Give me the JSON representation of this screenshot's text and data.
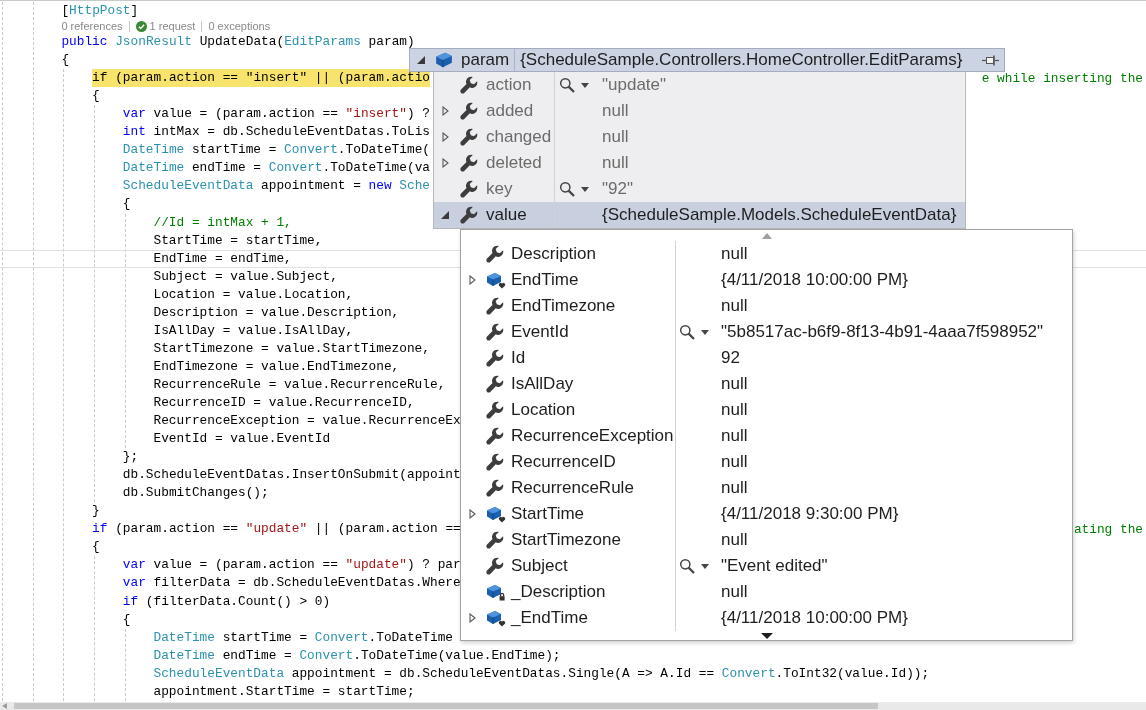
{
  "editor": {
    "lines": [
      {
        "kind": "code",
        "current": false,
        "caret": false,
        "tokens": [
          {
            "text": "[",
            "kind": "plain"
          },
          {
            "text": "HttpPost",
            "kind": "type"
          },
          {
            "text": "]",
            "kind": "plain"
          }
        ]
      },
      {
        "kind": "codelens",
        "items": [
          {
            "text": "0 references",
            "passed": false
          },
          {
            "text": "1 request",
            "passed": true
          },
          {
            "text": "0 exceptions",
            "passed": false
          }
        ]
      },
      {
        "kind": "code",
        "current": false,
        "caret": false,
        "tokens": [
          {
            "text": "public ",
            "kind": "keyword"
          },
          {
            "text": "JsonResult",
            "kind": "type"
          },
          {
            "text": " UpdateData(",
            "kind": "plain"
          },
          {
            "text": "EditParams",
            "kind": "type"
          },
          {
            "text": " param)",
            "kind": "plain"
          }
        ]
      },
      {
        "kind": "code",
        "current": false,
        "caret": false,
        "tokens": [
          {
            "text": "{",
            "kind": "plain"
          }
        ],
        "children": [
          {
            "kind": "code",
            "current": true,
            "caret": false,
            "tokens": [
              {
                "text": "if (param.action == \"insert\" || (param.actio",
                "kind": "plain"
              }
            ],
            "tail": {
              "text": "e while inserting the",
              "kind": "comment"
            }
          },
          {
            "kind": "code",
            "current": false,
            "caret": false,
            "tokens": [
              {
                "text": "{",
                "kind": "plain"
              }
            ],
            "children": [
              {
                "kind": "code",
                "current": false,
                "caret": false,
                "tokens": [
                  {
                    "text": "var ",
                    "kind": "keyword"
                  },
                  {
                    "text": "value = (param.action == ",
                    "kind": "plain"
                  },
                  {
                    "text": "\"insert\"",
                    "kind": "string"
                  },
                  {
                    "text": ") ?",
                    "kind": "plain"
                  }
                ]
              },
              {
                "kind": "code",
                "current": false,
                "caret": false,
                "tokens": [
                  {
                    "text": "int ",
                    "kind": "keyword"
                  },
                  {
                    "text": "intMax = db.ScheduleEventDatas.ToLis",
                    "kind": "plain"
                  }
                ]
              },
              {
                "kind": "code",
                "current": false,
                "caret": false,
                "tokens": [
                  {
                    "text": "DateTime",
                    "kind": "type"
                  },
                  {
                    "text": " startTime = ",
                    "kind": "plain"
                  },
                  {
                    "text": "Convert",
                    "kind": "type"
                  },
                  {
                    "text": ".ToDateTime(",
                    "kind": "plain"
                  }
                ]
              },
              {
                "kind": "code",
                "current": false,
                "caret": false,
                "tokens": [
                  {
                    "text": "DateTime",
                    "kind": "type"
                  },
                  {
                    "text": " endTime = ",
                    "kind": "plain"
                  },
                  {
                    "text": "Convert",
                    "kind": "type"
                  },
                  {
                    "text": ".ToDateTime(va",
                    "kind": "plain"
                  }
                ]
              },
              {
                "kind": "code",
                "current": false,
                "caret": false,
                "tokens": [
                  {
                    "text": "ScheduleEventData",
                    "kind": "type"
                  },
                  {
                    "text": " appointment = ",
                    "kind": "plain"
                  },
                  {
                    "text": "new ",
                    "kind": "keyword"
                  },
                  {
                    "text": "Sche",
                    "kind": "type"
                  }
                ]
              },
              {
                "kind": "code",
                "current": false,
                "caret": false,
                "tokens": [
                  {
                    "text": "{",
                    "kind": "plain"
                  }
                ],
                "children": [
                  {
                    "kind": "code",
                    "current": false,
                    "caret": false,
                    "tokens": [
                      {
                        "text": "//Id = intMax + 1,",
                        "kind": "comment"
                      }
                    ]
                  },
                  {
                    "kind": "code",
                    "current": false,
                    "caret": false,
                    "tokens": [
                      {
                        "text": "StartTime = startTime,",
                        "kind": "plain"
                      }
                    ]
                  },
                  {
                    "kind": "code",
                    "current": false,
                    "caret": true,
                    "tokens": [
                      {
                        "text": "EndTime = endTime,",
                        "kind": "plain"
                      }
                    ]
                  },
                  {
                    "kind": "code",
                    "current": false,
                    "caret": false,
                    "tokens": [
                      {
                        "text": "Subject = value.Subject,",
                        "kind": "plain"
                      }
                    ]
                  },
                  {
                    "kind": "code",
                    "current": false,
                    "caret": false,
                    "tokens": [
                      {
                        "text": "Location = value.Location,",
                        "kind": "plain"
                      }
                    ]
                  },
                  {
                    "kind": "code",
                    "current": false,
                    "caret": false,
                    "tokens": [
                      {
                        "text": "Description = value.Description,",
                        "kind": "plain"
                      }
                    ]
                  },
                  {
                    "kind": "code",
                    "current": false,
                    "caret": false,
                    "tokens": [
                      {
                        "text": "IsAllDay = value.IsAllDay,",
                        "kind": "plain"
                      }
                    ]
                  },
                  {
                    "kind": "code",
                    "current": false,
                    "caret": false,
                    "tokens": [
                      {
                        "text": "StartTimezone = value.StartTimezone,",
                        "kind": "plain"
                      }
                    ]
                  },
                  {
                    "kind": "code",
                    "current": false,
                    "caret": false,
                    "tokens": [
                      {
                        "text": "EndTimezone = value.EndTimezone,",
                        "kind": "plain"
                      }
                    ]
                  },
                  {
                    "kind": "code",
                    "current": false,
                    "caret": false,
                    "tokens": [
                      {
                        "text": "RecurrenceRule = value.RecurrenceRule,",
                        "kind": "plain"
                      }
                    ]
                  },
                  {
                    "kind": "code",
                    "current": false,
                    "caret": false,
                    "tokens": [
                      {
                        "text": "RecurrenceID = value.RecurrenceID,",
                        "kind": "plain"
                      }
                    ]
                  },
                  {
                    "kind": "code",
                    "current": false,
                    "caret": false,
                    "tokens": [
                      {
                        "text": "RecurrenceException = value.RecurrenceEx",
                        "kind": "plain"
                      }
                    ]
                  },
                  {
                    "kind": "code",
                    "current": false,
                    "caret": false,
                    "tokens": [
                      {
                        "text": "EventId = value.EventId",
                        "kind": "plain"
                      }
                    ]
                  }
                ]
              },
              {
                "kind": "code",
                "current": false,
                "caret": false,
                "tokens": [
                  {
                    "text": "};",
                    "kind": "plain"
                  }
                ]
              },
              {
                "kind": "code",
                "current": false,
                "caret": false,
                "tokens": [
                  {
                    "text": "db.ScheduleEventDatas.InsertOnSubmit(appoint",
                    "kind": "plain"
                  }
                ]
              },
              {
                "kind": "code",
                "current": false,
                "caret": false,
                "tokens": [
                  {
                    "text": "db.SubmitChanges();",
                    "kind": "plain"
                  }
                ]
              }
            ]
          },
          {
            "kind": "code",
            "current": false,
            "caret": false,
            "tokens": [
              {
                "text": "}",
                "kind": "plain"
              }
            ]
          },
          {
            "kind": "code",
            "current": false,
            "caret": false,
            "tokens": [
              {
                "text": "if ",
                "kind": "keyword"
              },
              {
                "text": "(param.action == ",
                "kind": "plain"
              },
              {
                "text": "\"update\"",
                "kind": "string"
              },
              {
                "text": " || (param.action ==",
                "kind": "plain"
              }
            ],
            "tail": {
              "text": "ating the",
              "kind": "comment"
            }
          },
          {
            "kind": "code",
            "current": false,
            "caret": false,
            "tokens": [
              {
                "text": "{",
                "kind": "plain"
              }
            ],
            "children": [
              {
                "kind": "code",
                "current": false,
                "caret": false,
                "tokens": [
                  {
                    "text": "var ",
                    "kind": "keyword"
                  },
                  {
                    "text": "value = (param.action == ",
                    "kind": "plain"
                  },
                  {
                    "text": "\"update\"",
                    "kind": "string"
                  },
                  {
                    "text": ") ? par",
                    "kind": "plain"
                  }
                ]
              },
              {
                "kind": "code",
                "current": false,
                "caret": false,
                "tokens": [
                  {
                    "text": "var ",
                    "kind": "keyword"
                  },
                  {
                    "text": "filterData = db.ScheduleEventDatas.Where",
                    "kind": "plain"
                  }
                ]
              },
              {
                "kind": "code",
                "current": false,
                "caret": false,
                "tokens": [
                  {
                    "text": "if ",
                    "kind": "keyword"
                  },
                  {
                    "text": "(filterData.Count() > 0)",
                    "kind": "plain"
                  }
                ]
              },
              {
                "kind": "code",
                "current": false,
                "caret": false,
                "tokens": [
                  {
                    "text": "{",
                    "kind": "plain"
                  }
                ],
                "children": [
                  {
                    "kind": "code",
                    "current": false,
                    "caret": false,
                    "tokens": [
                      {
                        "text": "DateTime",
                        "kind": "type"
                      },
                      {
                        "text": " startTime = ",
                        "kind": "plain"
                      },
                      {
                        "text": "Convert",
                        "kind": "type"
                      },
                      {
                        "text": ".ToDateTime",
                        "kind": "plain"
                      }
                    ]
                  },
                  {
                    "kind": "code",
                    "current": false,
                    "caret": false,
                    "tokens": [
                      {
                        "text": "DateTime",
                        "kind": "type"
                      },
                      {
                        "text": " endTime = ",
                        "kind": "plain"
                      },
                      {
                        "text": "Convert",
                        "kind": "type"
                      },
                      {
                        "text": ".ToDateTime(value.EndTime);",
                        "kind": "plain"
                      }
                    ]
                  },
                  {
                    "kind": "code",
                    "current": false,
                    "caret": false,
                    "tokens": [
                      {
                        "text": "ScheduleEventData",
                        "kind": "type"
                      },
                      {
                        "text": " appointment = db.ScheduleEventDatas.Single(A => A.Id == ",
                        "kind": "plain"
                      },
                      {
                        "text": "Convert",
                        "kind": "type"
                      },
                      {
                        "text": ".ToInt32(value.Id));",
                        "kind": "plain"
                      }
                    ]
                  },
                  {
                    "kind": "code",
                    "current": false,
                    "caret": false,
                    "tokens": [
                      {
                        "text": "appointment.StartTime = startTime;",
                        "kind": "plain"
                      }
                    ]
                  }
                ]
              }
            ]
          }
        ]
      }
    ]
  },
  "datatip": {
    "expanded": true,
    "kind": "object",
    "name": "param",
    "value": "{ScheduleSample.Controllers.HomeController.EditParams}",
    "members": [
      {
        "name": "action",
        "kind": "property",
        "expandable": false,
        "expanded": false,
        "visualizer": true,
        "value": "\"update\"",
        "selected": false
      },
      {
        "name": "added",
        "kind": "property",
        "expandable": true,
        "expanded": false,
        "visualizer": false,
        "value": "null",
        "selected": false
      },
      {
        "name": "changed",
        "kind": "property",
        "expandable": true,
        "expanded": false,
        "visualizer": false,
        "value": "null",
        "selected": false
      },
      {
        "name": "deleted",
        "kind": "property",
        "expandable": true,
        "expanded": false,
        "visualizer": false,
        "value": "null",
        "selected": false
      },
      {
        "name": "key",
        "kind": "property",
        "expandable": false,
        "expanded": false,
        "visualizer": true,
        "value": "\"92\"",
        "selected": false
      },
      {
        "name": "value",
        "kind": "property",
        "expandable": true,
        "expanded": true,
        "visualizer": false,
        "value": "{ScheduleSample.Models.ScheduleEventData}",
        "selected": true,
        "members": [
          {
            "name": "Description",
            "kind": "property",
            "expandable": false,
            "expanded": false,
            "visualizer": false,
            "value": "null",
            "selected": false
          },
          {
            "name": "EndTime",
            "kind": "internal",
            "expandable": true,
            "expanded": false,
            "visualizer": false,
            "value": "{4/11/2018 10:00:00 PM}",
            "selected": false
          },
          {
            "name": "EndTimezone",
            "kind": "property",
            "expandable": false,
            "expanded": false,
            "visualizer": false,
            "value": "null",
            "selected": false
          },
          {
            "name": "EventId",
            "kind": "property",
            "expandable": false,
            "expanded": false,
            "visualizer": true,
            "value": "\"5b8517ac-b6f9-8f13-4b91-4aaa7f598952\"",
            "selected": false
          },
          {
            "name": "Id",
            "kind": "property",
            "expandable": false,
            "expanded": false,
            "visualizer": false,
            "value": "92",
            "selected": false
          },
          {
            "name": "IsAllDay",
            "kind": "property",
            "expandable": false,
            "expanded": false,
            "visualizer": false,
            "value": "null",
            "selected": false
          },
          {
            "name": "Location",
            "kind": "property",
            "expandable": false,
            "expanded": false,
            "visualizer": false,
            "value": "null",
            "selected": false
          },
          {
            "name": "RecurrenceException",
            "kind": "property",
            "expandable": false,
            "expanded": false,
            "visualizer": false,
            "value": "null",
            "selected": false
          },
          {
            "name": "RecurrenceID",
            "kind": "property",
            "expandable": false,
            "expanded": false,
            "visualizer": false,
            "value": "null",
            "selected": false
          },
          {
            "name": "RecurrenceRule",
            "kind": "property",
            "expandable": false,
            "expanded": false,
            "visualizer": false,
            "value": "null",
            "selected": false
          },
          {
            "name": "StartTime",
            "kind": "internal",
            "expandable": true,
            "expanded": false,
            "visualizer": false,
            "value": "{4/11/2018 9:30:00 PM}",
            "selected": false
          },
          {
            "name": "StartTimezone",
            "kind": "property",
            "expandable": false,
            "expanded": false,
            "visualizer": false,
            "value": "null",
            "selected": false
          },
          {
            "name": "Subject",
            "kind": "property",
            "expandable": false,
            "expanded": false,
            "visualizer": true,
            "value": "\"Event edited\"",
            "selected": false
          },
          {
            "name": "_Description",
            "kind": "private",
            "expandable": false,
            "expanded": false,
            "visualizer": false,
            "value": "null",
            "selected": false
          },
          {
            "name": "_EndTime",
            "kind": "internal",
            "expandable": true,
            "expanded": false,
            "visualizer": false,
            "value": "{4/11/2018 10:00:00 PM}",
            "selected": false
          }
        ]
      }
    ]
  }
}
